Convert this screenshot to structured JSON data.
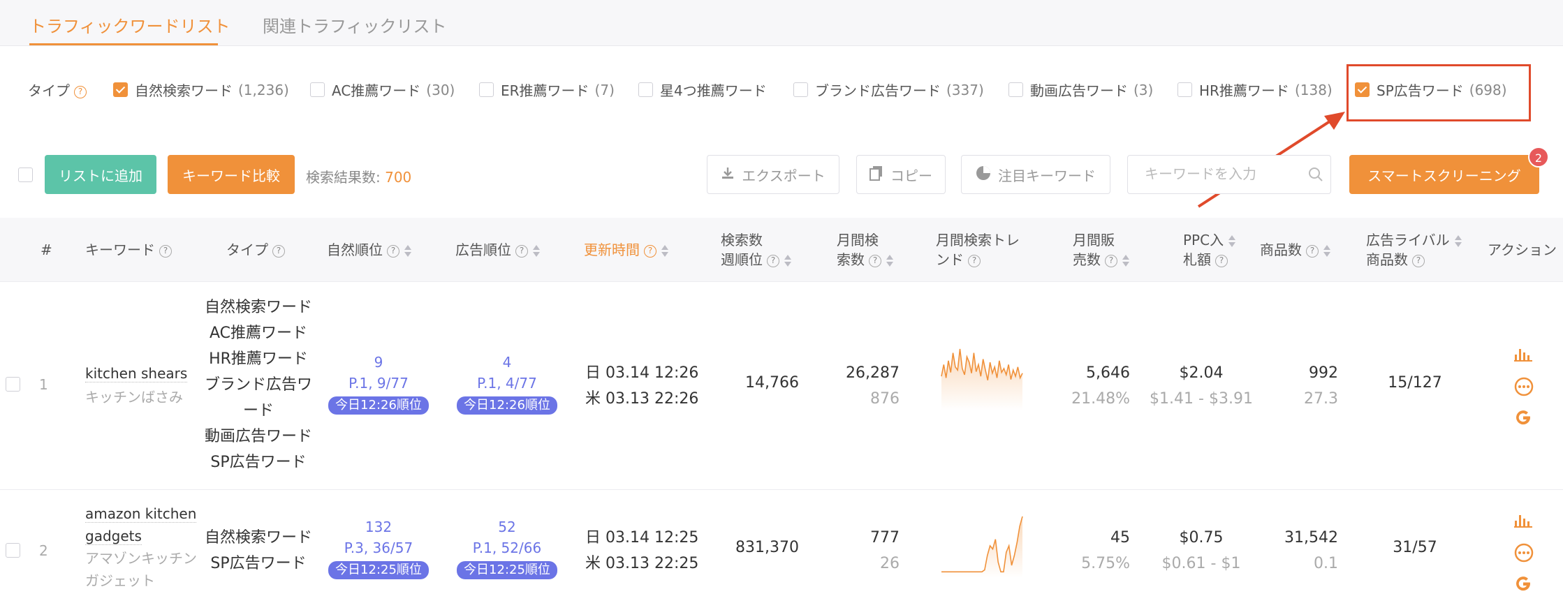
{
  "tabs": [
    {
      "label": "トラフィックワードリスト",
      "active": true
    },
    {
      "label": "関連トラフィックリスト",
      "active": false
    }
  ],
  "filters": {
    "type_label": "タイプ",
    "items": [
      {
        "label": "自然検索ワード",
        "count": "(1,236)",
        "checked": true
      },
      {
        "label": "AC推薦ワード",
        "count": "(30)",
        "checked": false
      },
      {
        "label": "ER推薦ワード",
        "count": "(7)",
        "checked": false
      },
      {
        "label": "星4つ推薦ワード",
        "count": "",
        "checked": false
      },
      {
        "label": "ブランド広告ワード",
        "count": "(337)",
        "checked": false
      },
      {
        "label": "動画広告ワード",
        "count": "(3)",
        "checked": false
      },
      {
        "label": "HR推薦ワード",
        "count": "(138)",
        "checked": false
      },
      {
        "label": "SP広告ワード",
        "count": "(698)",
        "checked": true
      }
    ]
  },
  "toolbar": {
    "add_to_list": "リストに追加",
    "compare": "キーワード比較",
    "result_label": "検索結果数:",
    "result_count": "700",
    "export": "エクスポート",
    "copy": "コピー",
    "watch": "注目キーワード",
    "search_placeholder": "キーワードを入力",
    "smart_screening": "スマートスクリーニング",
    "badge": "2"
  },
  "columns": {
    "index": "#",
    "keyword": "キーワード",
    "type": "タイプ",
    "organic_rank": "自然順位",
    "ad_rank": "広告順位",
    "updated": "更新時間",
    "search_rank_1": "検索数",
    "search_rank_2": "週順位",
    "monthly_search_1": "月間検",
    "monthly_search_2": "索数",
    "trend_1": "月間検索トレ",
    "trend_2": "ンド",
    "monthly_sales_1": "月間販",
    "monthly_sales_2": "売数",
    "ppc_1": "PPC入",
    "ppc_2": "札額",
    "products": "商品数",
    "rivals_1": "広告ライバル",
    "rivals_2": "商品数",
    "action": "アクション"
  },
  "rows": [
    {
      "index": "1",
      "keyword": "kitchen shears",
      "keyword_jp": "キッチンばさみ",
      "types": [
        "自然検索ワード",
        "AC推薦ワード",
        "HR推薦ワード",
        "ブランド広告ワ",
        "ード",
        "動画広告ワード",
        "SP広告ワード"
      ],
      "organic_rank": "9",
      "organic_pos": "P.1, 9/77",
      "organic_pill": "今日12:26順位",
      "ad_rank": "4",
      "ad_pos": "P.1, 4/77",
      "ad_pill": "今日12:26順位",
      "updated_jp": "日 03.14 12:26",
      "updated_us": "米 03.13 22:26",
      "search_rank": "14,766",
      "monthly_search": "26,287",
      "monthly_search_sub": "876",
      "monthly_sales": "5,646",
      "monthly_sales_sub": "21.48%",
      "ppc": "$2.04",
      "ppc_range": "$1.41 - $3.91",
      "products": "992",
      "products_sub": "27.3",
      "rivals": "15/127",
      "trend": [
        40,
        55,
        38,
        60,
        45,
        70,
        52,
        48,
        75,
        50,
        42,
        65,
        58,
        44,
        70,
        46,
        55,
        40,
        62,
        48,
        35,
        58,
        44,
        52,
        38,
        60,
        45,
        50,
        42,
        55,
        36,
        48,
        40,
        52,
        38,
        44
      ]
    },
    {
      "index": "2",
      "keyword": "amazon kitchen",
      "keyword_2": "gadgets",
      "keyword_jp": "アマゾンキッチン",
      "keyword_jp_2": "ガジェット",
      "types": [
        "自然検索ワード",
        "SP広告ワード"
      ],
      "organic_rank": "132",
      "organic_pos": "P.3, 36/57",
      "organic_pill": "今日12:25順位",
      "ad_rank": "52",
      "ad_pos": "P.1, 52/66",
      "ad_pill": "今日12:25順位",
      "updated_jp": "日 03.14 12:25",
      "updated_us": "米 03.13 22:25",
      "search_rank": "831,370",
      "monthly_search": "777",
      "monthly_search_sub": "26",
      "monthly_sales": "45",
      "monthly_sales_sub": "5.75%",
      "ppc": "$0.75",
      "ppc_range": "$0.61 - $1",
      "products": "31,542",
      "products_sub": "0.1",
      "rivals": "31/57",
      "trend": [
        5,
        5,
        5,
        5,
        5,
        5,
        5,
        5,
        5,
        5,
        5,
        5,
        5,
        5,
        5,
        5,
        8,
        30,
        45,
        40,
        55,
        20,
        5,
        5,
        35,
        45,
        15,
        30,
        50,
        75,
        90
      ]
    }
  ],
  "colors": {
    "accent": "#f0913a",
    "green": "#5cc4a8",
    "blue": "#6b74e6",
    "highlight": "#e04a2b"
  }
}
